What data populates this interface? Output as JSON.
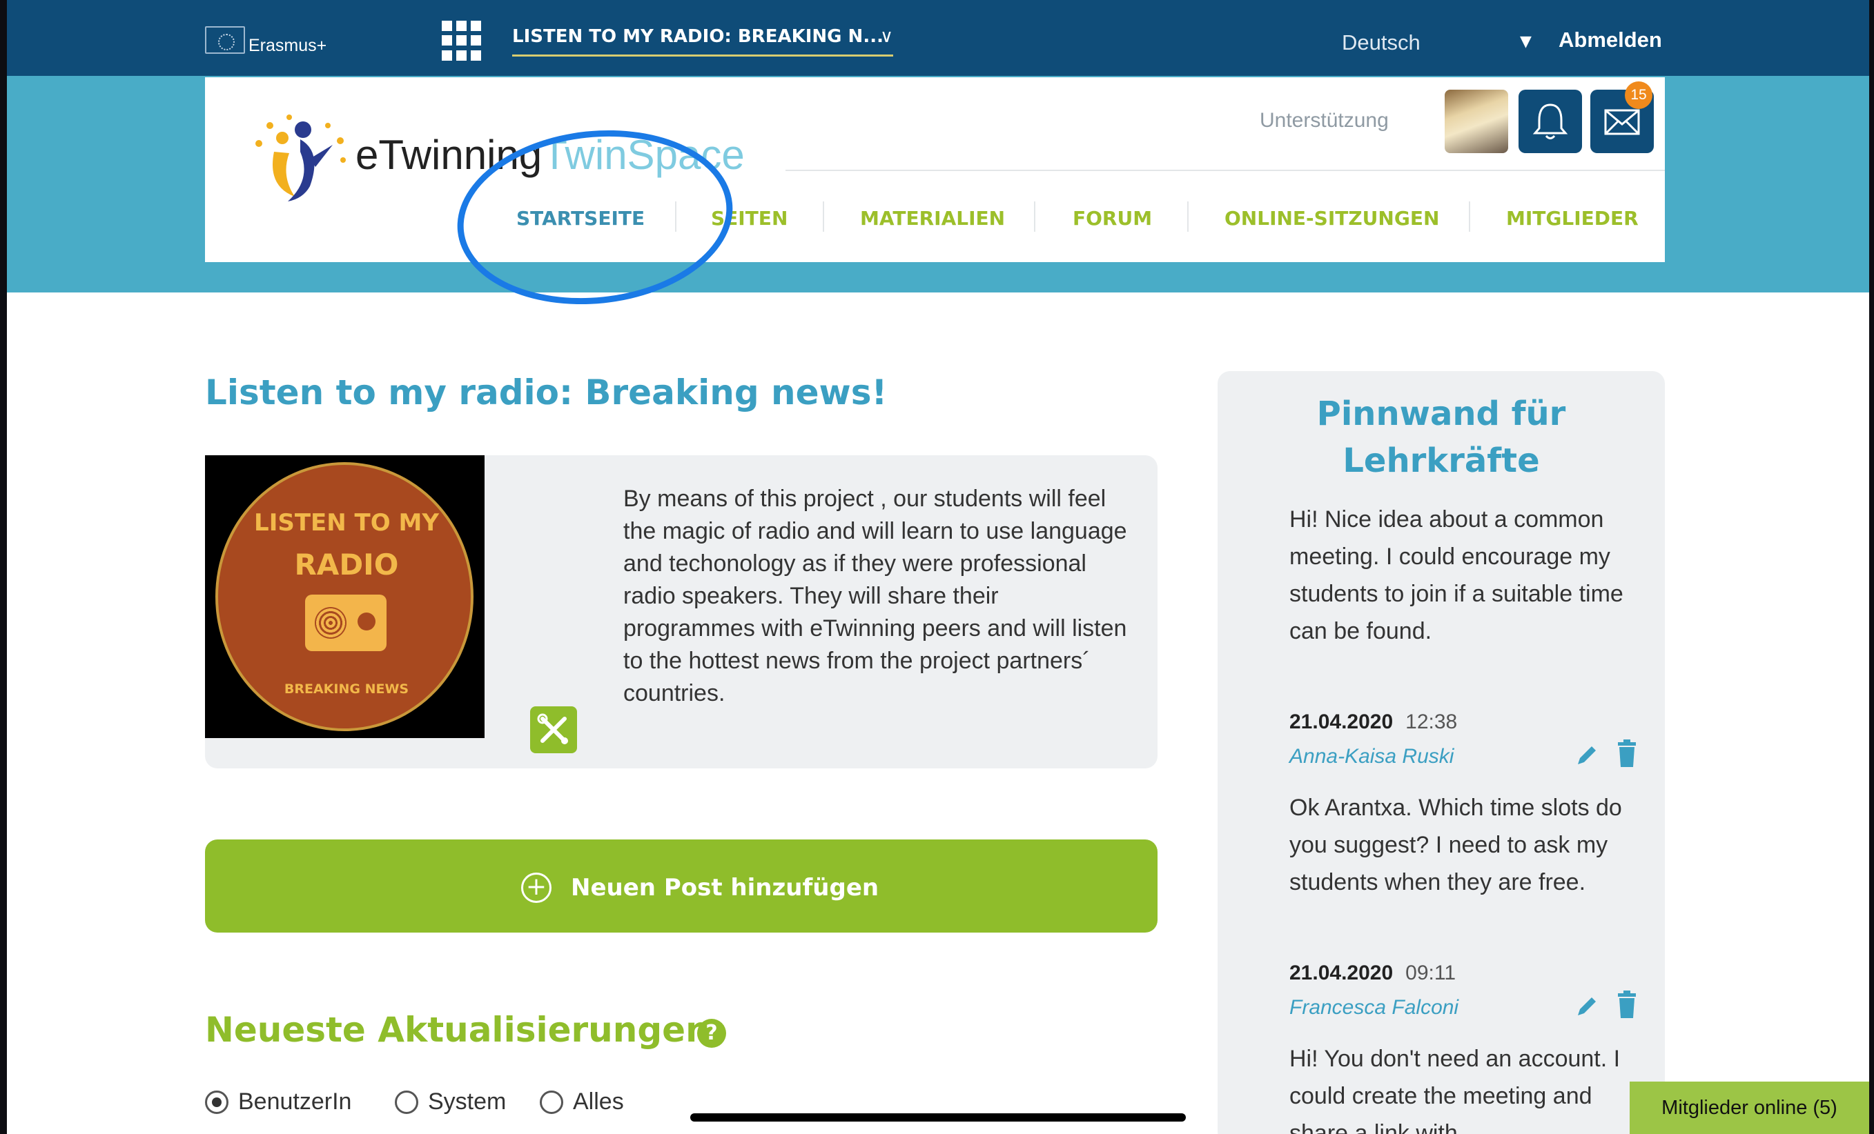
{
  "topbar": {
    "brand": "Erasmus+",
    "project_selector": "LISTEN TO MY RADIO: BREAKING N...",
    "language": "Deutsch",
    "logout": "Abmelden"
  },
  "header": {
    "logo_text_dark": "eTwinning",
    "logo_text_light": "TwinSpace",
    "support": "Unterstützung",
    "notifications_badge": "15"
  },
  "nav": {
    "items": [
      "STARTSEITE",
      "SEITEN",
      "MATERIALIEN",
      "FORUM",
      "ONLINE-SITZUNGEN",
      "MITGLIEDER"
    ],
    "active": "STARTSEITE"
  },
  "project": {
    "title": "Listen to my radio: Breaking news!",
    "image_line1": "LISTEN TO MY",
    "image_line2": "RADIO",
    "image_line3": "BREAKING NEWS",
    "description": "By means of this project , our students will feel the magic of radio and will learn to use language and techonology as if they were professional radio speakers. They will share their programmes with eTwinning peers and will listen to the hottest news from the project partners´ countries."
  },
  "new_post_button": "Neuen Post hinzufügen",
  "updates": {
    "title": "Neueste Aktualisierungen",
    "help": "?",
    "filters": [
      "BenutzerIn",
      "System",
      "Alles"
    ],
    "selected_filter": "BenutzerIn"
  },
  "board": {
    "title": "Pinnwand für Lehrkräfte",
    "posts": [
      {
        "text": "Hi! Nice idea about a common meeting. I could encourage my students to join if a suitable time can be found.",
        "date": "21.04.2020",
        "time": "12:38",
        "author": "Anna-Kaisa Ruski"
      },
      {
        "text": "Ok Arantxa. Which time slots do you suggest? I need to ask my students when they are free.",
        "date": "21.04.2020",
        "time": "09:11",
        "author": "Francesca Falconi"
      },
      {
        "text": "Hi! You don't need an account. I could create the meeting and share a link with"
      }
    ]
  },
  "online_members": "Mitglieder online (5)",
  "colors": {
    "topbar": "#0f4c78",
    "teal": "#49acc7",
    "green": "#8fbd2b",
    "title_blue": "#3b9fc2",
    "badge_orange": "#f08a1c",
    "annotation_blue": "#1a7ae6"
  }
}
